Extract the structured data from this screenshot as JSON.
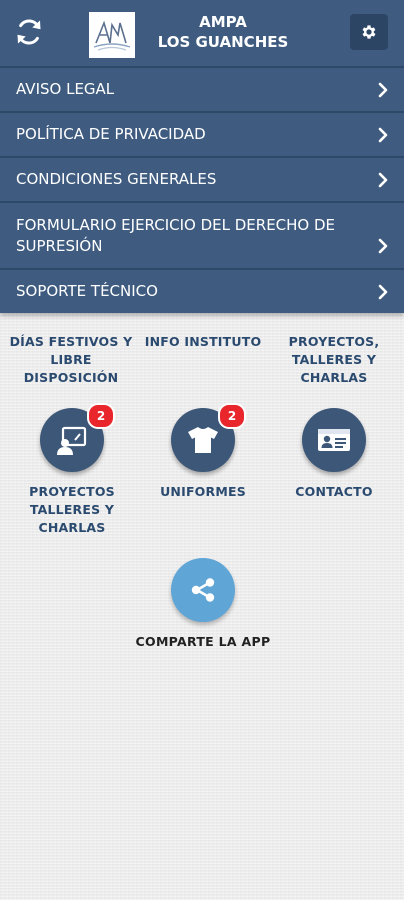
{
  "header": {
    "title_line1": "AMPA",
    "title_line2": "LOS GUANCHES",
    "logo_text": "AMPA",
    "background_color": "#3f5c80"
  },
  "menu": {
    "items": [
      {
        "label": "AVISO LEGAL",
        "icon": "chevron-right-icon"
      },
      {
        "label": "POLÍTICA DE PRIVACIDAD",
        "icon": "chevron-right-icon"
      },
      {
        "label": "CONDICIONES GENERALES",
        "icon": "chevron-right-icon"
      },
      {
        "label": "FORMULARIO EJERCICIO DEL DERECHO DE SUPRESIÓN",
        "icon": "chevron-right-icon"
      },
      {
        "label": "SOPORTE TÉCNICO",
        "icon": "chevron-right-icon"
      }
    ]
  },
  "grid": {
    "top_labels": [
      "DÍAS FESTIVOS Y LIBRE DISPOSICIÓN",
      "INFO INSTITUTO",
      "PROYECTOS, TALLERES Y CHARLAS"
    ],
    "tiles": [
      {
        "label": "PROYECTOS TALLERES Y CHARLAS",
        "icon": "presentation-icon",
        "badge": "2"
      },
      {
        "label": "UNIFORMES",
        "icon": "tshirt-icon",
        "badge": "2"
      },
      {
        "label": "CONTACTO",
        "icon": "contact-card-icon",
        "badge": ""
      }
    ]
  },
  "share": {
    "label": "COMPARTE LA APP",
    "icon": "share-icon",
    "color": "#5fa5d6"
  },
  "colors": {
    "tile": "#3c5778",
    "badge": "#e8262b",
    "label_text": "#2b4a6f"
  }
}
